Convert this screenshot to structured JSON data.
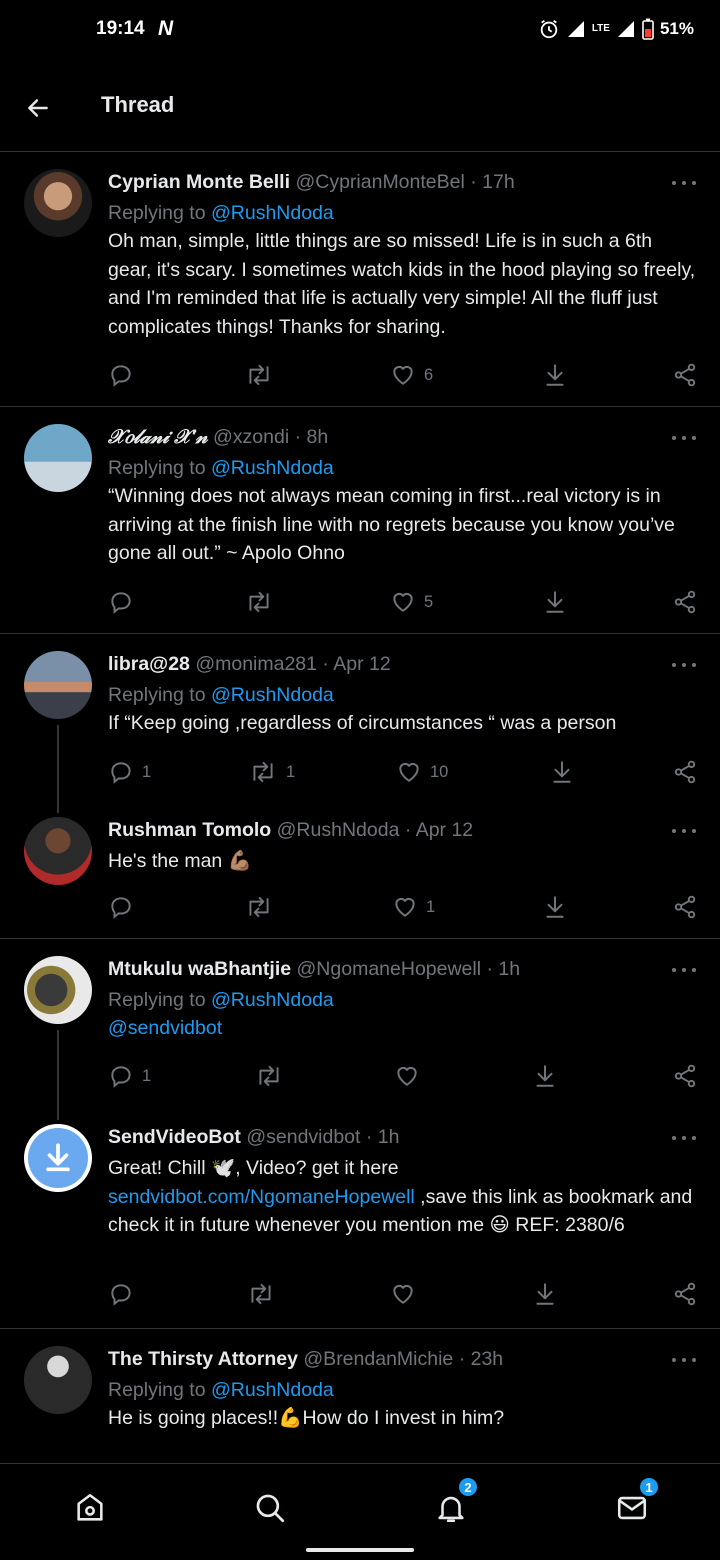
{
  "status_bar": {
    "time": "19:14",
    "notif_glyph": "N",
    "battery": "51%",
    "network": "LTE"
  },
  "header": {
    "title": "Thread",
    "back_icon": "arrow-left-icon"
  },
  "tweets": [
    {
      "name": "Cyprian Monte Belli",
      "handle": "@CyprianMonteBel",
      "time": "17h",
      "replying_label": "Replying to",
      "replying_to": "@RushNdoda",
      "text": "Oh man, simple, little things are so missed! Life is in such a 6th gear, it's scary. I sometimes watch kids in the hood playing so freely, and I'm reminded that life is actually very simple! All the fluff just complicates things! Thanks for sharing.",
      "replies": "",
      "retweets": "",
      "likes": "6"
    },
    {
      "name": "𝒳𝑜𝓁𝒶𝓃𝒾 𝒳'𝓃",
      "handle": "@xzondi",
      "time": "8h",
      "replying_label": "Replying to",
      "replying_to": "@RushNdoda",
      "text": "“Winning does not always mean coming in first...real victory is in arriving at the finish line with no regrets because you know you’ve gone all out.” ~ Apolo Ohno",
      "replies": "",
      "retweets": "",
      "likes": "5"
    },
    {
      "name": "libra@28",
      "handle": "@monima281",
      "time": "Apr 12",
      "replying_label": "Replying to",
      "replying_to": "@RushNdoda",
      "text": "If “Keep going ,regardless of circumstances “ was a person",
      "replies": "1",
      "retweets": "1",
      "likes": "10"
    },
    {
      "name": "Rushman Tomolo",
      "handle": "@RushNdoda",
      "time": "Apr 12",
      "text": "He's the man 💪🏽",
      "replies": "",
      "retweets": "",
      "likes": "1"
    },
    {
      "name": "Mtukulu waBhantjie",
      "handle": "@NgomaneHopewell",
      "time": "1h",
      "replying_label": "Replying to",
      "replying_to": "@RushNdoda",
      "mention": "@sendvidbot",
      "replies": "1",
      "retweets": "",
      "likes": ""
    },
    {
      "name": "SendVideoBot",
      "handle": "@sendvidbot",
      "time": "1h",
      "text_a": "Great! Chill 🕊️, Video? get it here",
      "link": "sendvidbot.com/NgomaneHopewell",
      "text_b": " ,save this link as bookmark and check it in future whenever you mention me 😃 REF: 2380/6",
      "replies": "",
      "retweets": "",
      "likes": ""
    },
    {
      "name": "The Thirsty Attorney",
      "handle": "@BrendanMichie",
      "time": "23h",
      "replying_label": "Replying to",
      "replying_to": "@RushNdoda",
      "text": "He is going places!!💪How do I invest in him?"
    }
  ],
  "separator": "·",
  "bottom_nav": {
    "items": [
      "home-icon",
      "search-icon",
      "notifications-icon",
      "messages-icon"
    ],
    "notifications_badge": "2",
    "messages_badge": "1"
  },
  "colors": {
    "background": "#000000",
    "accent": "#1d9bf0",
    "muted": "#71767b",
    "text": "#e7e9ea",
    "divider": "#2f3336"
  }
}
